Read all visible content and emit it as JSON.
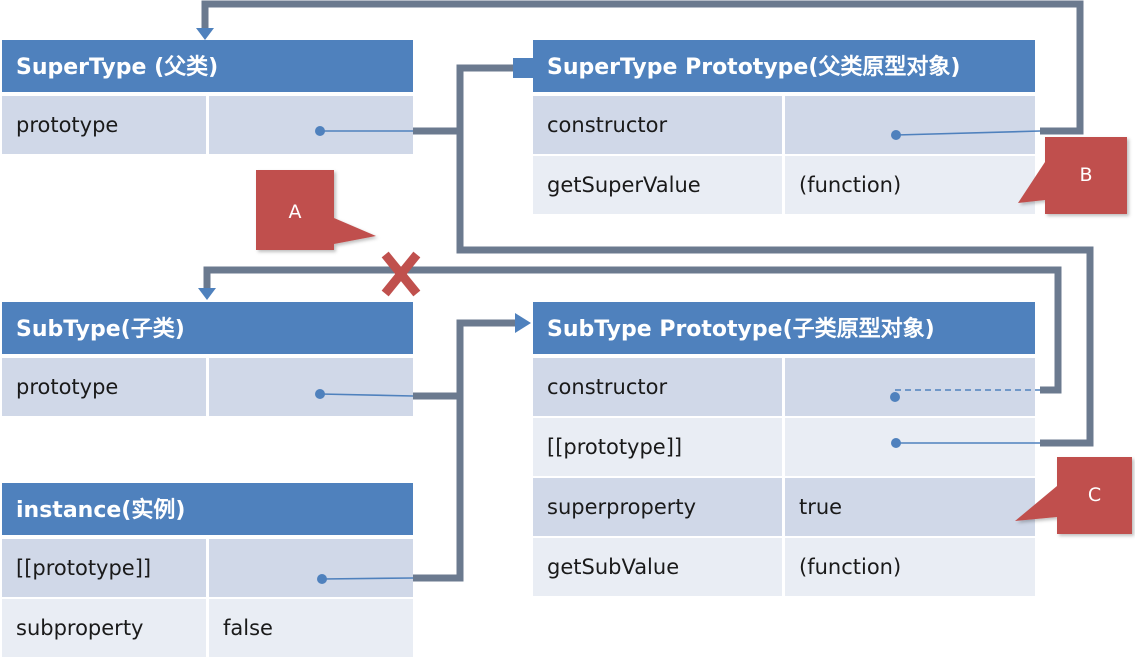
{
  "tables": {
    "supertype": {
      "title": "SuperType (父类)",
      "rows": [
        {
          "key": "prototype",
          "value": ""
        }
      ]
    },
    "supertype_proto": {
      "title": "SuperType Prototype(父类原型对象)",
      "rows": [
        {
          "key": "constructor",
          "value": ""
        },
        {
          "key": "getSuperValue",
          "value": "(function)"
        }
      ]
    },
    "subtype": {
      "title": "SubType(子类)",
      "rows": [
        {
          "key": "prototype",
          "value": ""
        }
      ]
    },
    "subtype_proto": {
      "title": "SubType Prototype(子类原型对象)",
      "rows": [
        {
          "key": "constructor",
          "value": ""
        },
        {
          "key": "[[prototype]]",
          "value": ""
        },
        {
          "key": "superproperty",
          "value": "true"
        },
        {
          "key": "getSubValue",
          "value": "(function)"
        }
      ]
    },
    "instance": {
      "title": "instance(实例)",
      "rows": [
        {
          "key": "[[prototype]]",
          "value": ""
        },
        {
          "key": "subproperty",
          "value": "false"
        }
      ]
    }
  },
  "callouts": {
    "a": "A",
    "b": "B",
    "c": "C"
  },
  "colors": {
    "header": "#4f81bd",
    "row_dark": "#d0d8e8",
    "row_light": "#e9edf4",
    "connector": "#6b7a8f",
    "pointer": "#4f81bd",
    "callout": "#c0504d",
    "cross": "#c0504d"
  }
}
